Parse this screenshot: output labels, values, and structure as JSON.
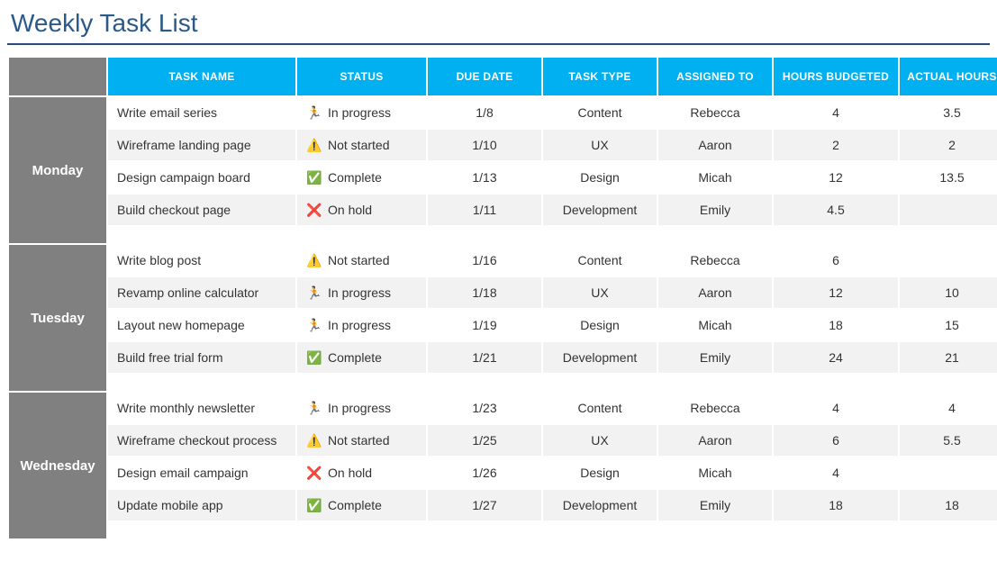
{
  "title": "Weekly Task List",
  "columns": [
    "TASK NAME",
    "STATUS",
    "DUE DATE",
    "TASK TYPE",
    "ASSIGNED TO",
    "HOURS BUDGETED",
    "ACTUAL HOURS"
  ],
  "status_icons": {
    "in_progress": "🏃",
    "not_started": "⚠️",
    "complete": "✅",
    "on_hold": "❌"
  },
  "status_labels": {
    "in_progress": "In progress",
    "not_started": "Not started",
    "complete": "Complete",
    "on_hold": "On hold"
  },
  "days": [
    {
      "name": "Monday",
      "rows": [
        {
          "task": "Write email series",
          "status": "in_progress",
          "due": "1/8",
          "type": "Content",
          "assigned": "Rebecca",
          "budget": "4",
          "actual": "3.5"
        },
        {
          "task": "Wireframe landing page",
          "status": "not_started",
          "due": "1/10",
          "type": "UX",
          "assigned": "Aaron",
          "budget": "2",
          "actual": "2"
        },
        {
          "task": "Design campaign board",
          "status": "complete",
          "due": "1/13",
          "type": "Design",
          "assigned": "Micah",
          "budget": "12",
          "actual": "13.5"
        },
        {
          "task": "Build checkout page",
          "status": "on_hold",
          "due": "1/11",
          "type": "Development",
          "assigned": "Emily",
          "budget": "4.5",
          "actual": ""
        }
      ]
    },
    {
      "name": "Tuesday",
      "rows": [
        {
          "task": "Write blog post",
          "status": "not_started",
          "due": "1/16",
          "type": "Content",
          "assigned": "Rebecca",
          "budget": "6",
          "actual": ""
        },
        {
          "task": "Revamp online calculator",
          "status": "in_progress",
          "due": "1/18",
          "type": "UX",
          "assigned": "Aaron",
          "budget": "12",
          "actual": "10"
        },
        {
          "task": "Layout new homepage",
          "status": "in_progress",
          "due": "1/19",
          "type": "Design",
          "assigned": "Micah",
          "budget": "18",
          "actual": "15"
        },
        {
          "task": "Build free trial form",
          "status": "complete",
          "due": "1/21",
          "type": "Development",
          "assigned": "Emily",
          "budget": "24",
          "actual": "21"
        }
      ]
    },
    {
      "name": "Wednesday",
      "rows": [
        {
          "task": "Write monthly newsletter",
          "status": "in_progress",
          "due": "1/23",
          "type": "Content",
          "assigned": "Rebecca",
          "budget": "4",
          "actual": "4"
        },
        {
          "task": "Wireframe checkout process",
          "status": "not_started",
          "due": "1/25",
          "type": "UX",
          "assigned": "Aaron",
          "budget": "6",
          "actual": "5.5"
        },
        {
          "task": "Design email campaign",
          "status": "on_hold",
          "due": "1/26",
          "type": "Design",
          "assigned": "Micah",
          "budget": "4",
          "actual": ""
        },
        {
          "task": "Update mobile app",
          "status": "complete",
          "due": "1/27",
          "type": "Development",
          "assigned": "Emily",
          "budget": "18",
          "actual": "18"
        }
      ]
    }
  ]
}
